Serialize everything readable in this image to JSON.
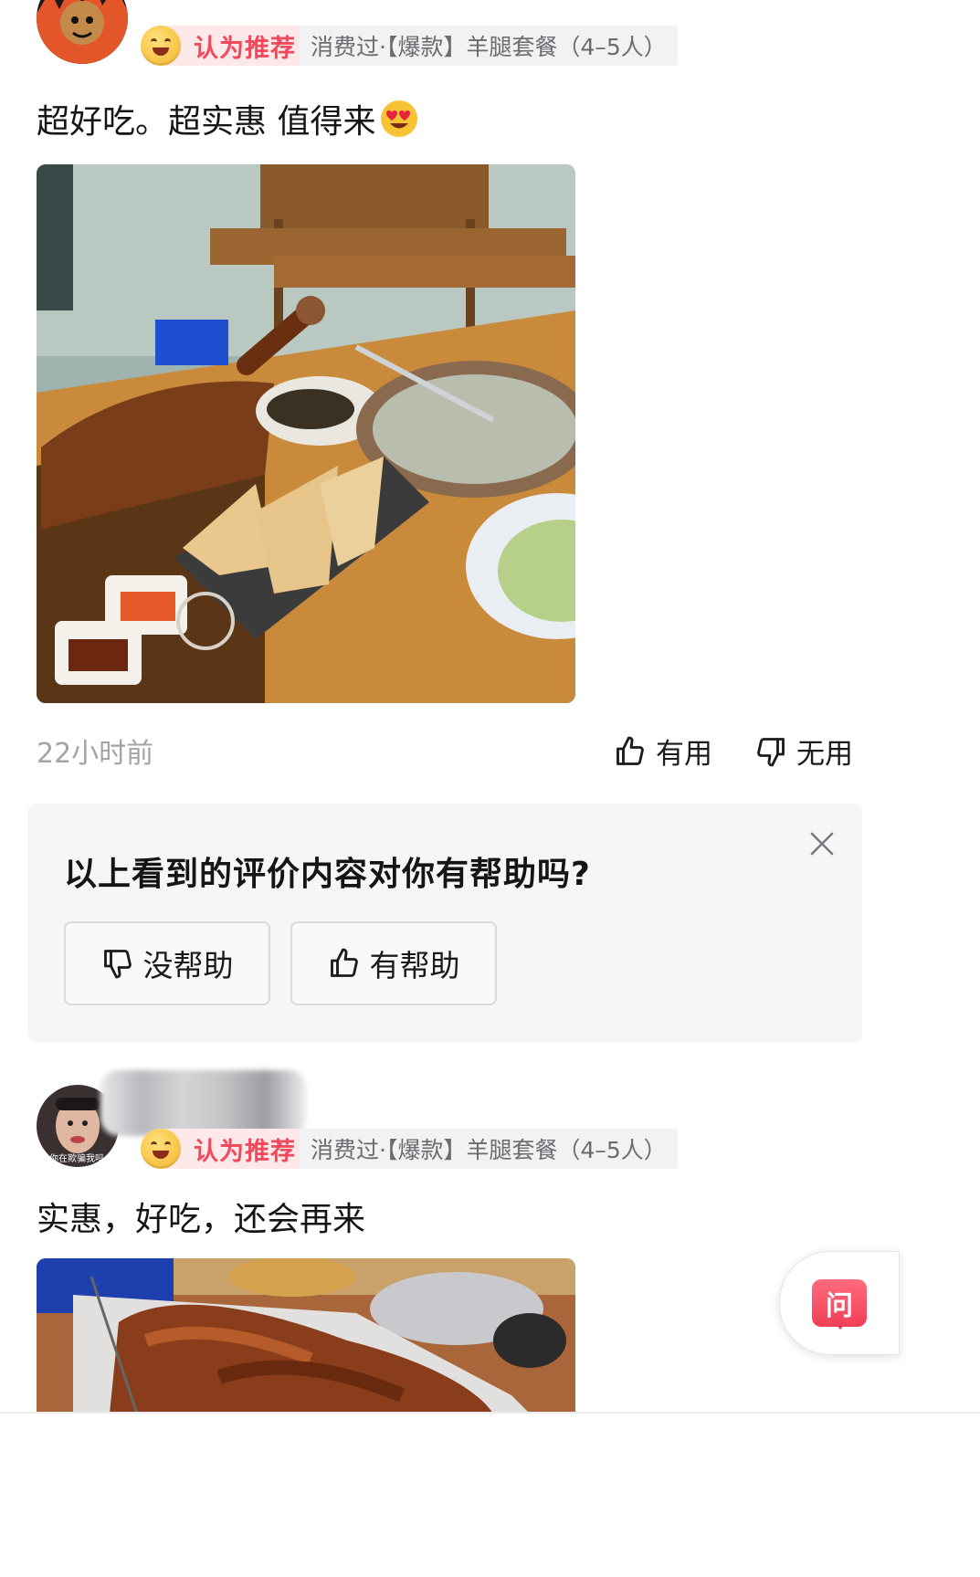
{
  "review1": {
    "recommend_label": "认为推荐",
    "consumed_label": "消费过·【爆款】羊腿套餐（4–5人）",
    "text": "超好吃。超实惠 值得来",
    "emoji": "😍",
    "time": "22小时前",
    "useful_label": "有用",
    "useless_label": "无用"
  },
  "survey": {
    "question": "以上看到的评价内容对你有帮助吗?",
    "no_help_label": "没帮助",
    "help_label": "有帮助"
  },
  "review2": {
    "avatar_caption": "你在欺骗我吗",
    "recommend_label": "认为推荐",
    "consumed_label": "消费过·【爆款】羊腿套餐（4–5人）",
    "text": "实惠，好吃，还会再来"
  },
  "fab": {
    "label": "问"
  },
  "icons": [
    "thumbs-up-icon",
    "thumbs-down-icon",
    "close-icon",
    "smile-face-icon",
    "heart-eyes-emoji-icon",
    "question-icon"
  ],
  "colors": {
    "accent_red": "#f04a5c",
    "pill_bg": "#fde8ea",
    "survey_bg": "#f6f6f8"
  }
}
